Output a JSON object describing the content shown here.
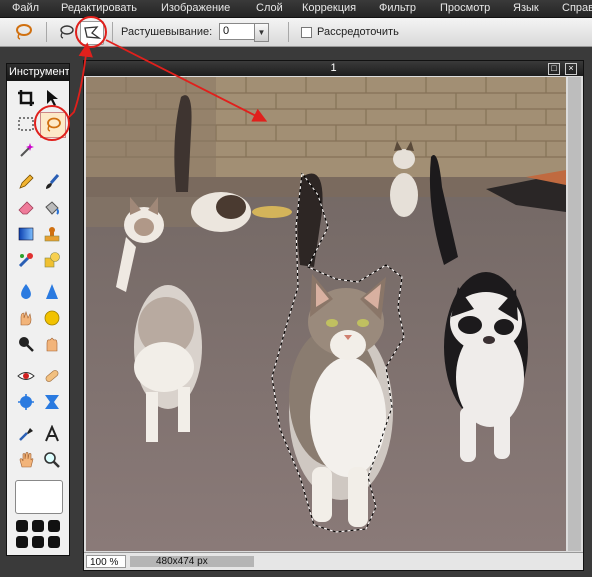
{
  "menubar": {
    "items": [
      "Файл",
      "Редактировать",
      "Изображение",
      "Слой",
      "Коррекция",
      "Фильтр",
      "Просмотр",
      "Язык",
      "Справ"
    ]
  },
  "options": {
    "feather_label": "Растушевывание:",
    "feather_value": "0",
    "antialias_label": "Рассредоточить",
    "antialias_checked": false
  },
  "toolbox": {
    "title": "Инструменты",
    "icons": [
      "crop-icon",
      "move-icon",
      "marquee-icon",
      "lasso-icon",
      "magic-wand-icon",
      "pencil-icon",
      "brush-icon",
      "eraser-icon",
      "bucket-icon",
      "gradient-icon",
      "stamp-icon",
      "color-replace-icon",
      "shape-icon",
      "blur-icon",
      "sharpen-icon",
      "smudge-icon",
      "sponge-icon",
      "dodge-icon",
      "burn-icon",
      "red-eye-icon",
      "spot-heal-icon",
      "bloat-icon",
      "pinch-icon",
      "eyedropper-icon",
      "text-icon",
      "hand-icon",
      "zoom-icon"
    ]
  },
  "document": {
    "title": "1",
    "zoom": "100 %",
    "size": "480x474 px"
  },
  "colors": {
    "accent_red": "#e0201c",
    "panel_bg": "#f0f0f0",
    "titlebar": "#1d1d1d"
  }
}
